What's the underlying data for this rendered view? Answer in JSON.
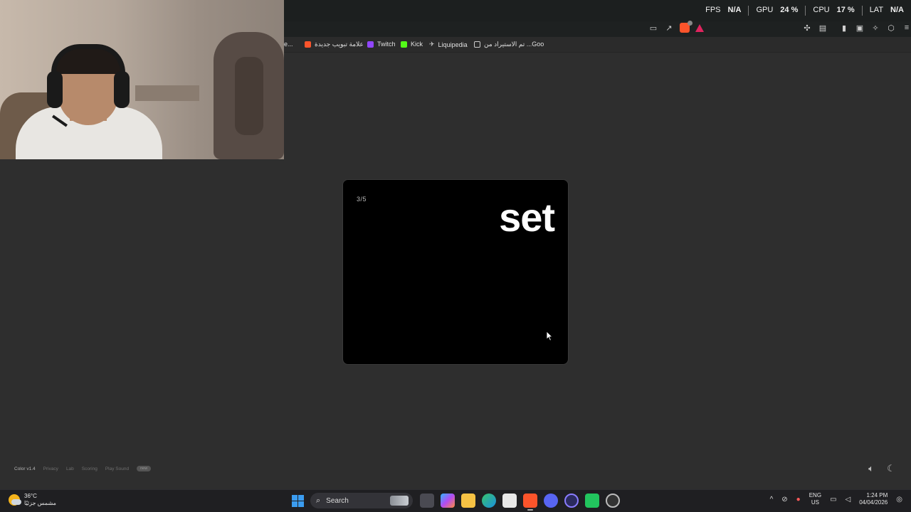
{
  "perf": {
    "fps_label": "FPS",
    "fps_value": "N/A",
    "gpu_label": "GPU",
    "gpu_value": "24 %",
    "cpu_label": "CPU",
    "cpu_value": "17 %",
    "lat_label": "LAT",
    "lat_value": "N/A"
  },
  "bookmarks": [
    {
      "label": "e...",
      "icon": "bookmark-icon"
    },
    {
      "label": "علامة تبويب جديدة",
      "icon": "brave-icon",
      "color": "#fb542b"
    },
    {
      "label": "Twitch",
      "icon": "twitch-icon",
      "color": "#9146ff"
    },
    {
      "label": "Kick",
      "icon": "kick-icon",
      "color": "#53fc18"
    },
    {
      "label": "Liquipedia",
      "icon": "liquipedia-icon",
      "color": "#cccccc"
    },
    {
      "label": "تم الاستيراد من ...Goo",
      "icon": "folder-icon",
      "color": "#cccccc"
    }
  ],
  "card": {
    "counter": "3/5",
    "word": "set"
  },
  "footer": {
    "version": "Color v1.4",
    "privacy": "Privacy",
    "lab": "Lab",
    "scoring": "Scoring",
    "play_sound": "Play Sound",
    "new_badge": "new"
  },
  "taskbar": {
    "temperature": "36°C",
    "weather_desc": "مشمس جزئيًا",
    "search_placeholder": "Search",
    "lang_top": "ENG",
    "lang_bottom": "US",
    "time": "1:24 PM",
    "date": "04/04/2026"
  },
  "colors": {
    "background": "#2e2e2e",
    "card": "#000000",
    "accent": "#3b9cf0"
  }
}
